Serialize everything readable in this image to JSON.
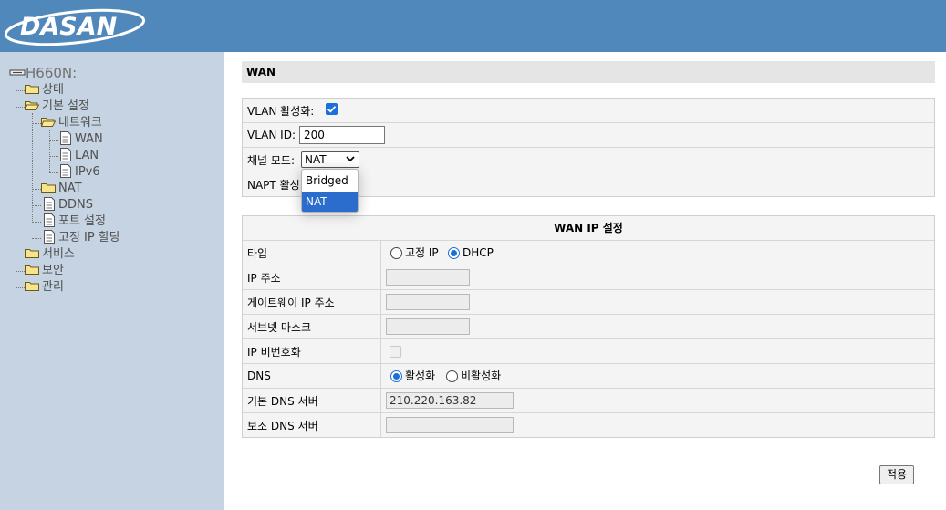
{
  "brand": {
    "logo_text": "DASAN"
  },
  "sidebar": {
    "root": "H660N:",
    "items": [
      {
        "label": "상태"
      },
      {
        "label": "기본 설정"
      },
      {
        "label": "네트워크"
      },
      {
        "label": "WAN"
      },
      {
        "label": "LAN"
      },
      {
        "label": "IPv6"
      },
      {
        "label": "NAT"
      },
      {
        "label": "DDNS"
      },
      {
        "label": "포트 설정"
      },
      {
        "label": "고정 IP 할당"
      },
      {
        "label": "서비스"
      },
      {
        "label": "보안"
      },
      {
        "label": "관리"
      }
    ]
  },
  "page": {
    "title": "WAN"
  },
  "settings": {
    "vlan_enable_label": "VLAN 활성화:",
    "vlan_enable_checked": true,
    "vlan_id_label": "VLAN ID:",
    "vlan_id_value": "200",
    "channel_mode_label": "채널 모드:",
    "channel_mode_value": "NAT",
    "channel_mode_options": [
      "Bridged",
      "NAT"
    ],
    "napt_label": "NAPT 활성"
  },
  "wan_ip": {
    "header": "WAN IP 설정",
    "type_label": "타입",
    "type_options": [
      "고정 IP",
      "DHCP"
    ],
    "type_selected": "DHCP",
    "ip_label": "IP 주소",
    "gateway_label": "게이트웨이 IP 주소",
    "subnet_label": "서브넷 마스크",
    "ip_unnumbered_label": "IP 비번호화",
    "dns_label": "DNS",
    "dns_options": [
      "활성화",
      "비활성화"
    ],
    "dns_selected": "활성화",
    "primary_dns_label": "기본 DNS 서버",
    "primary_dns_value": "210.220.163.82",
    "secondary_dns_label": "보조 DNS 서버",
    "secondary_dns_value": ""
  },
  "actions": {
    "apply_label": "적용"
  },
  "colors": {
    "header": "#5088bb",
    "sidebar": "#c5d3e2",
    "accent": "#1a6fd8"
  }
}
